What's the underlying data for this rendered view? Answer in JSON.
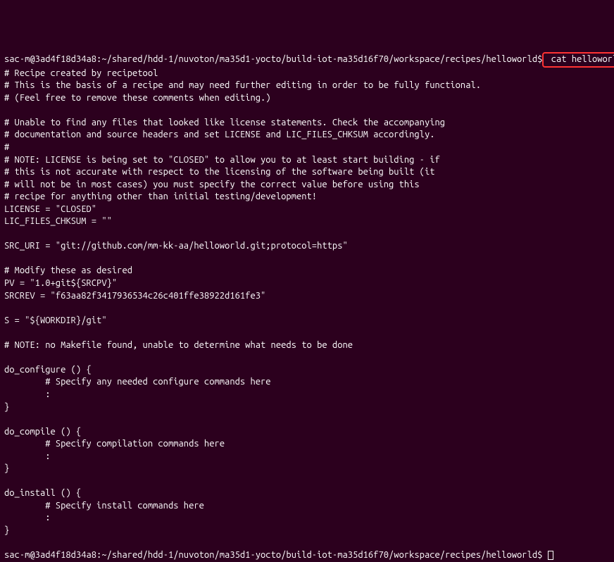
{
  "prompt1": {
    "user_host": "sac-m@3ad4f18d34a8",
    "separator": ":",
    "path": "~/shared/hdd-1/nuvoton/ma35d1-yocto/build-iot-ma35d16f70/workspace/recipes/helloworld",
    "dollar": "$",
    "command": " cat helloworld_git.bb"
  },
  "output": {
    "l01": "# Recipe created by recipetool",
    "l02": "# This is the basis of a recipe and may need further editing in order to be fully functional.",
    "l03": "# (Feel free to remove these comments when editing.)",
    "l04": "",
    "l05": "# Unable to find any files that looked like license statements. Check the accompanying",
    "l06": "# documentation and source headers and set LICENSE and LIC_FILES_CHKSUM accordingly.",
    "l07": "#",
    "l08": "# NOTE: LICENSE is being set to \"CLOSED\" to allow you to at least start building - if",
    "l09": "# this is not accurate with respect to the licensing of the software being built (it",
    "l10": "# will not be in most cases) you must specify the correct value before using this",
    "l11": "# recipe for anything other than initial testing/development!",
    "l12": "LICENSE = \"CLOSED\"",
    "l13": "LIC_FILES_CHKSUM = \"\"",
    "l14": "",
    "l15": "SRC_URI = \"git://github.com/mm-kk-aa/helloworld.git;protocol=https\"",
    "l16": "",
    "l17": "# Modify these as desired",
    "l18": "PV = \"1.0+git${SRCPV}\"",
    "l19": "SRCREV = \"f63aa82f3417936534c26c401ffe38922d161fe3\"",
    "l20": "",
    "l21": "S = \"${WORKDIR}/git\"",
    "l22": "",
    "l23": "# NOTE: no Makefile found, unable to determine what needs to be done",
    "l24": "",
    "l25": "do_configure () {",
    "l26": "        # Specify any needed configure commands here",
    "l27": "        :",
    "l28": "}",
    "l29": "",
    "l30": "do_compile () {",
    "l31": "        # Specify compilation commands here",
    "l32": "        :",
    "l33": "}",
    "l34": "",
    "l35": "do_install () {",
    "l36": "        # Specify install commands here",
    "l37": "        :",
    "l38": "}",
    "l39": ""
  },
  "prompt2": {
    "user_host": "sac-m@3ad4f18d34a8",
    "separator": ":",
    "path": "~/shared/hdd-1/nuvoton/ma35d1-yocto/build-iot-ma35d16f70/workspace/recipes/helloworld",
    "dollar": "$ "
  }
}
